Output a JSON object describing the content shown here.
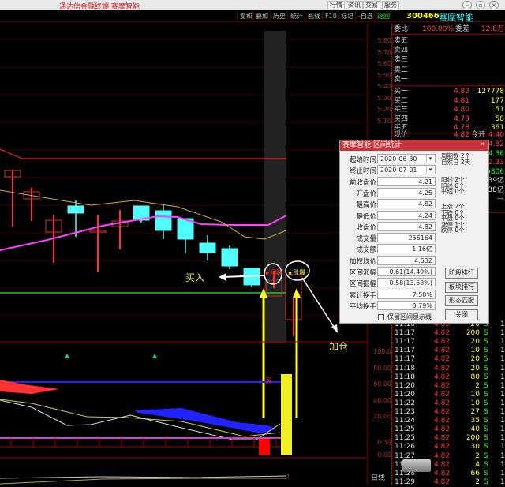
{
  "window": {
    "title": "通达信金融终端 赛摩智能",
    "nav": [
      "行情",
      "资讯",
      "交易",
      "服务"
    ],
    "controls": [
      "–",
      "▫",
      "×"
    ]
  },
  "toolbar": {
    "buttons": [
      "复权",
      "叠加",
      "历史",
      "统计",
      "画线",
      "F10",
      "标记",
      "-自选",
      "返回"
    ]
  },
  "stock": {
    "code": "300466",
    "name": "赛摩智能"
  },
  "quote": {
    "weibi_label": "委比",
    "weibi": "100.00%",
    "weicha_label": "委差",
    "weicha": "12.8万",
    "sell": [
      {
        "label": "卖五"
      },
      {
        "label": "卖四"
      },
      {
        "label": "卖三"
      },
      {
        "label": "卖二"
      },
      {
        "label": "卖一"
      }
    ],
    "buy": [
      {
        "label": "买一",
        "price": "4.82",
        "vol": "127778"
      },
      {
        "label": "买二",
        "price": "4.81",
        "vol": "177"
      },
      {
        "label": "买三",
        "price": "4.80",
        "vol": "51"
      },
      {
        "label": "买四",
        "price": "4.79",
        "vol": "58"
      },
      {
        "label": "买五",
        "price": "4.78",
        "vol": "361"
      }
    ],
    "now_label": "现价",
    "now": "4.82",
    "open_label": "今开",
    "open": "4.40",
    "right_values": [
      "4.82",
      "4.36",
      "2.33",
      "5806",
      "39亿",
      "38亿",
      "—"
    ]
  },
  "price_axis": [
    "5.80",
    "5.70",
    "5.60",
    "5.50",
    "5.40",
    "5.30",
    "5.20",
    "5.10"
  ],
  "indicator_axis": [
    "100.0",
    "80.00",
    "60.00",
    "40.00",
    "20.00"
  ],
  "indicator2_axis": [
    "0.30",
    "0.00"
  ],
  "period_label": "日线",
  "bottom_tick": "7",
  "trades": [
    [
      "11:16",
      "4.82",
      "20",
      "S",
      "1"
    ],
    [
      "11:17",
      "4.82",
      "200",
      "S",
      "1"
    ],
    [
      "11:17",
      "4.82",
      "20",
      "S",
      "1"
    ],
    [
      "11:17",
      "4.82",
      "10",
      "S",
      "1"
    ],
    [
      "11:17",
      "4.82",
      "20",
      "S",
      "1"
    ],
    [
      "11:18",
      "4.82",
      "20",
      "S",
      "1"
    ],
    [
      "11:18",
      "4.82",
      "80",
      "S",
      "1"
    ],
    [
      "11:20",
      "4.82",
      "2",
      "S",
      "1"
    ],
    [
      "11:20",
      "4.82",
      "10",
      "S",
      "1"
    ],
    [
      "11:22",
      "4.82",
      "10",
      "S",
      "1"
    ],
    [
      "11:23",
      "4.82",
      "27",
      "S",
      "1"
    ],
    [
      "11:24",
      "4.82",
      "35",
      "S",
      "1"
    ],
    [
      "11:25",
      "4.82",
      "40",
      "S",
      "1"
    ],
    [
      "11:25",
      "4.82",
      "200",
      "S",
      "1"
    ],
    [
      "11:26",
      "4.82",
      "30",
      "S",
      "1"
    ],
    [
      "11:27",
      "4.82",
      "2",
      "S",
      "1"
    ],
    [
      "11:28",
      "4.82",
      "4",
      "S",
      "1"
    ],
    [
      "11:28",
      "4.82",
      "66",
      "S",
      "1"
    ],
    [
      "11:29",
      "4.82",
      "2",
      "S",
      "1"
    ]
  ],
  "dialog": {
    "title": "赛摩智能 区间统计",
    "close": "×",
    "fields": [
      {
        "label": "起始时间",
        "value": "2020-06-30",
        "select": true
      },
      {
        "label": "终止时间",
        "value": "2020-07-01",
        "select": true
      },
      {
        "label": "前收盘价",
        "value": "4.21"
      },
      {
        "label": "开盘价",
        "value": "4.25"
      },
      {
        "label": "最高价",
        "value": "4.82"
      },
      {
        "label": "最低价",
        "value": "4.24"
      },
      {
        "label": "收盘价",
        "value": "4.82"
      },
      {
        "label": "成交量",
        "value": "256164"
      },
      {
        "label": "成交额",
        "value": "1.16亿"
      },
      {
        "label": "加权均价",
        "value": "4.532"
      },
      {
        "label": "区间涨幅",
        "value": "0.61(14.49%)"
      },
      {
        "label": "区间振幅",
        "value": "0.58(13.68%)"
      },
      {
        "label": "累计换手",
        "value": "7.58%"
      },
      {
        "label": "平均换手",
        "value": "3.79%"
      }
    ],
    "stats1": [
      "周期数 2个",
      "自然日 2天"
    ],
    "stats2": [
      "阳线 2个",
      "阴线 0个",
      "平线 0个"
    ],
    "stats3": [
      "上涨 2个",
      "下跌 0个",
      "平盘 0个",
      "涨停 1个",
      "跌停 0个"
    ],
    "buttons": [
      "阶段排行",
      "板块排行",
      "形态匹配",
      "关闭"
    ],
    "checkbox_label": "保留区间显示线"
  },
  "annotations": {
    "buy": "买入",
    "add": "加仓",
    "signal1": "★回踩",
    "signal2": "★引爆",
    "vertical": "买"
  },
  "colors": {
    "up": "#ff3030",
    "down": "#50ffff",
    "ma1": "#ff40ff",
    "ma2": "#c8b040",
    "accent": "#c8343a"
  }
}
